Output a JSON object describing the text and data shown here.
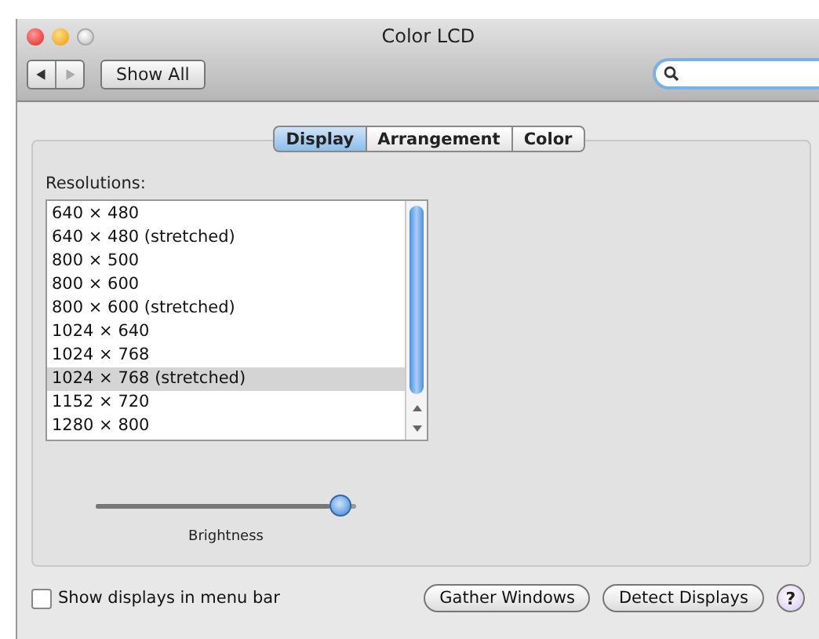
{
  "window": {
    "title": "Color LCD"
  },
  "toolbar": {
    "show_all": "Show All"
  },
  "tabs": [
    {
      "label": "Display",
      "selected": true
    },
    {
      "label": "Arrangement",
      "selected": false
    },
    {
      "label": "Color",
      "selected": false
    }
  ],
  "resolutions": {
    "label": "Resolutions:",
    "items": [
      {
        "label": "640 × 480",
        "selected": false
      },
      {
        "label": "640 × 480 (stretched)",
        "selected": false
      },
      {
        "label": "800 × 500",
        "selected": false
      },
      {
        "label": "800 × 600",
        "selected": false
      },
      {
        "label": "800 × 600 (stretched)",
        "selected": false
      },
      {
        "label": "1024 × 640",
        "selected": false
      },
      {
        "label": "1024 × 768",
        "selected": false
      },
      {
        "label": "1024 × 768 (stretched)",
        "selected": true
      },
      {
        "label": "1152 × 720",
        "selected": false
      },
      {
        "label": "1280 × 800",
        "selected": false
      }
    ]
  },
  "brightness": {
    "label": "Brightness",
    "level": 0.98
  },
  "menu_bar_checkbox": {
    "label": "Show displays in menu bar",
    "checked": false
  },
  "buttons": [
    "Gather Windows",
    "Detect Displays"
  ],
  "help": "?"
}
